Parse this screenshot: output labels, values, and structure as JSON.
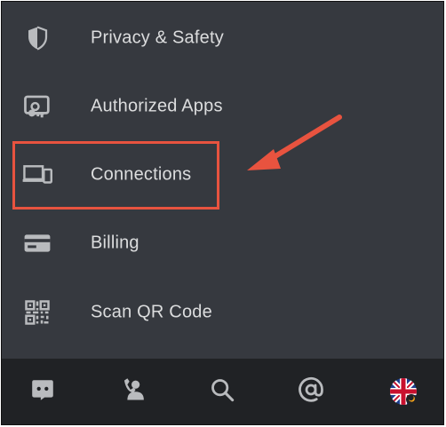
{
  "menu": {
    "items": [
      {
        "label": "Privacy & Safety",
        "icon": "shield-icon"
      },
      {
        "label": "Authorized Apps",
        "icon": "authorized-apps-icon"
      },
      {
        "label": "Connections",
        "icon": "connections-devices-icon"
      },
      {
        "label": "Billing",
        "icon": "credit-card-icon"
      },
      {
        "label": "Scan QR Code",
        "icon": "qr-code-icon"
      }
    ]
  },
  "annotation": {
    "highlighted_item": "Connections",
    "color": "#e8533f"
  },
  "bottom_nav": {
    "items": [
      {
        "icon": "discord-home-icon"
      },
      {
        "icon": "friends-icon"
      },
      {
        "icon": "search-icon"
      },
      {
        "icon": "mentions-icon"
      },
      {
        "icon": "user-avatar"
      }
    ]
  },
  "colors": {
    "background": "#36393f",
    "bottom_bar": "#202225",
    "text": "#dcddde",
    "icon": "#b9bbbe",
    "accent_annotation": "#e8533f"
  }
}
